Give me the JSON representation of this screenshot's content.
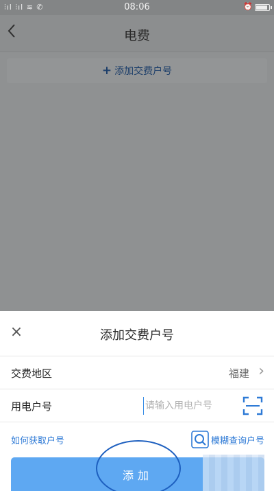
{
  "status_bar": {
    "signal": "⫶ıl ⫶ıl ≋ ✆",
    "time": "08:06",
    "alarm": "⏰"
  },
  "nav": {
    "back_icon": "chevron-left",
    "title": "电费"
  },
  "background": {
    "add_account_plus": "+",
    "add_account_label": "添加交费户号"
  },
  "sheet": {
    "close_glyph": "×",
    "title": "添加交费户号",
    "region_label": "交费地区",
    "region_value": "福建",
    "region_chevron": "›",
    "account_label": "用电户号",
    "account_value": "",
    "account_placeholder": "请输入用电户号",
    "help_link": "如何获取户号",
    "fuzzy_query_link": "模糊查询户号",
    "submit_label": "添加"
  },
  "colors": {
    "accent": "#2e7ad6",
    "button": "#5ea8f2",
    "overlay": "#8f9192"
  }
}
